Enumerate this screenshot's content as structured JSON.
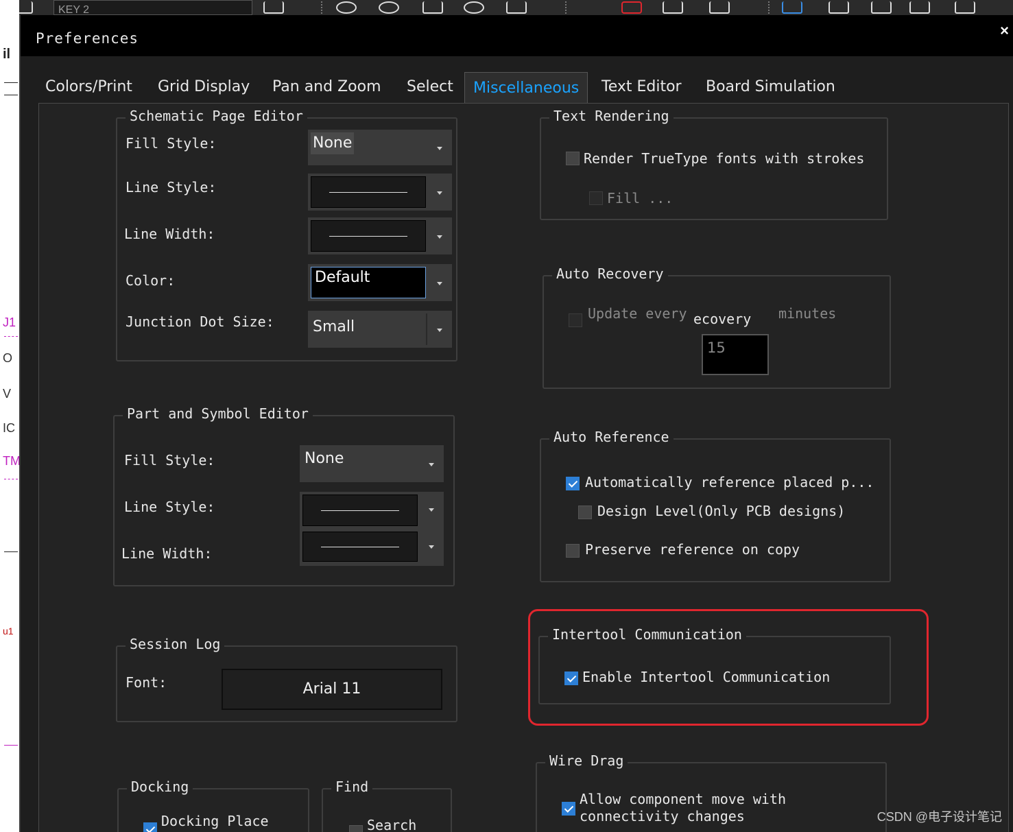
{
  "background": {
    "toolbar_field": "KEY 2",
    "left_marks": [
      "il",
      "J1",
      "O",
      "V",
      "IC",
      "TM",
      "u1"
    ]
  },
  "dialog": {
    "title": "Preferences",
    "close_glyph": "×"
  },
  "tabs": [
    {
      "label": "Colors/Print",
      "active": false
    },
    {
      "label": "Grid Display",
      "active": false
    },
    {
      "label": "Pan and Zoom",
      "active": false
    },
    {
      "label": "Select",
      "active": false
    },
    {
      "label": "Miscellaneous",
      "active": true
    },
    {
      "label": "Text Editor",
      "active": false
    },
    {
      "label": "Board Simulation",
      "active": false
    }
  ],
  "schematic_page_editor": {
    "title": "Schematic Page Editor",
    "fill_style_label": "Fill Style:",
    "fill_style_value": "None",
    "line_style_label": "Line Style:",
    "line_width_label": "Line Width:",
    "color_label": "Color:",
    "color_value": "Default",
    "junction_label": "Junction Dot Size:",
    "junction_value": "Small"
  },
  "part_symbol_editor": {
    "title": "Part and Symbol Editor",
    "fill_style_label": "Fill Style:",
    "fill_style_value": "None",
    "line_style_label": "Line Style:",
    "line_width_label": "Line Width:"
  },
  "session_log": {
    "title": "Session Log",
    "font_label": "Font:",
    "font_value": "Arial 11"
  },
  "docking": {
    "title": "Docking",
    "docking_place_label": "Docking Place",
    "docking_place_checked": true
  },
  "find": {
    "title": "Find",
    "search_label": "Search",
    "search_checked": false
  },
  "text_rendering": {
    "title": "Text Rendering",
    "truetype_label": "Render TrueType fonts with strokes",
    "truetype_checked": false,
    "fill_label": "Fill ...",
    "fill_checked": false
  },
  "auto_recovery": {
    "title": "Auto Recovery",
    "update_label": "Update every",
    "overlap_text": "ecovery",
    "minutes_label": "minutes",
    "update_checked": false,
    "minutes_value": "15"
  },
  "auto_reference": {
    "title": "Auto Reference",
    "auto_ref_label": "Automatically reference placed p...",
    "auto_ref_checked": true,
    "design_level_label": "Design Level(Only PCB designs)",
    "design_level_checked": false,
    "preserve_label": "Preserve reference on copy",
    "preserve_checked": false
  },
  "intertool": {
    "title": "Intertool Communication",
    "enable_label": "Enable Intertool Communication",
    "enable_checked": true
  },
  "wire_drag": {
    "title": "Wire Drag",
    "allow_label_line1": "Allow component move with",
    "allow_label_line2": "connectivity changes",
    "allow_checked": true
  },
  "watermark": "CSDN @电子设计笔记",
  "colors": {
    "accent_tab": "#1aa3ff",
    "highlight": "#e0262e",
    "checkbox_on": "#2d7fd6"
  }
}
